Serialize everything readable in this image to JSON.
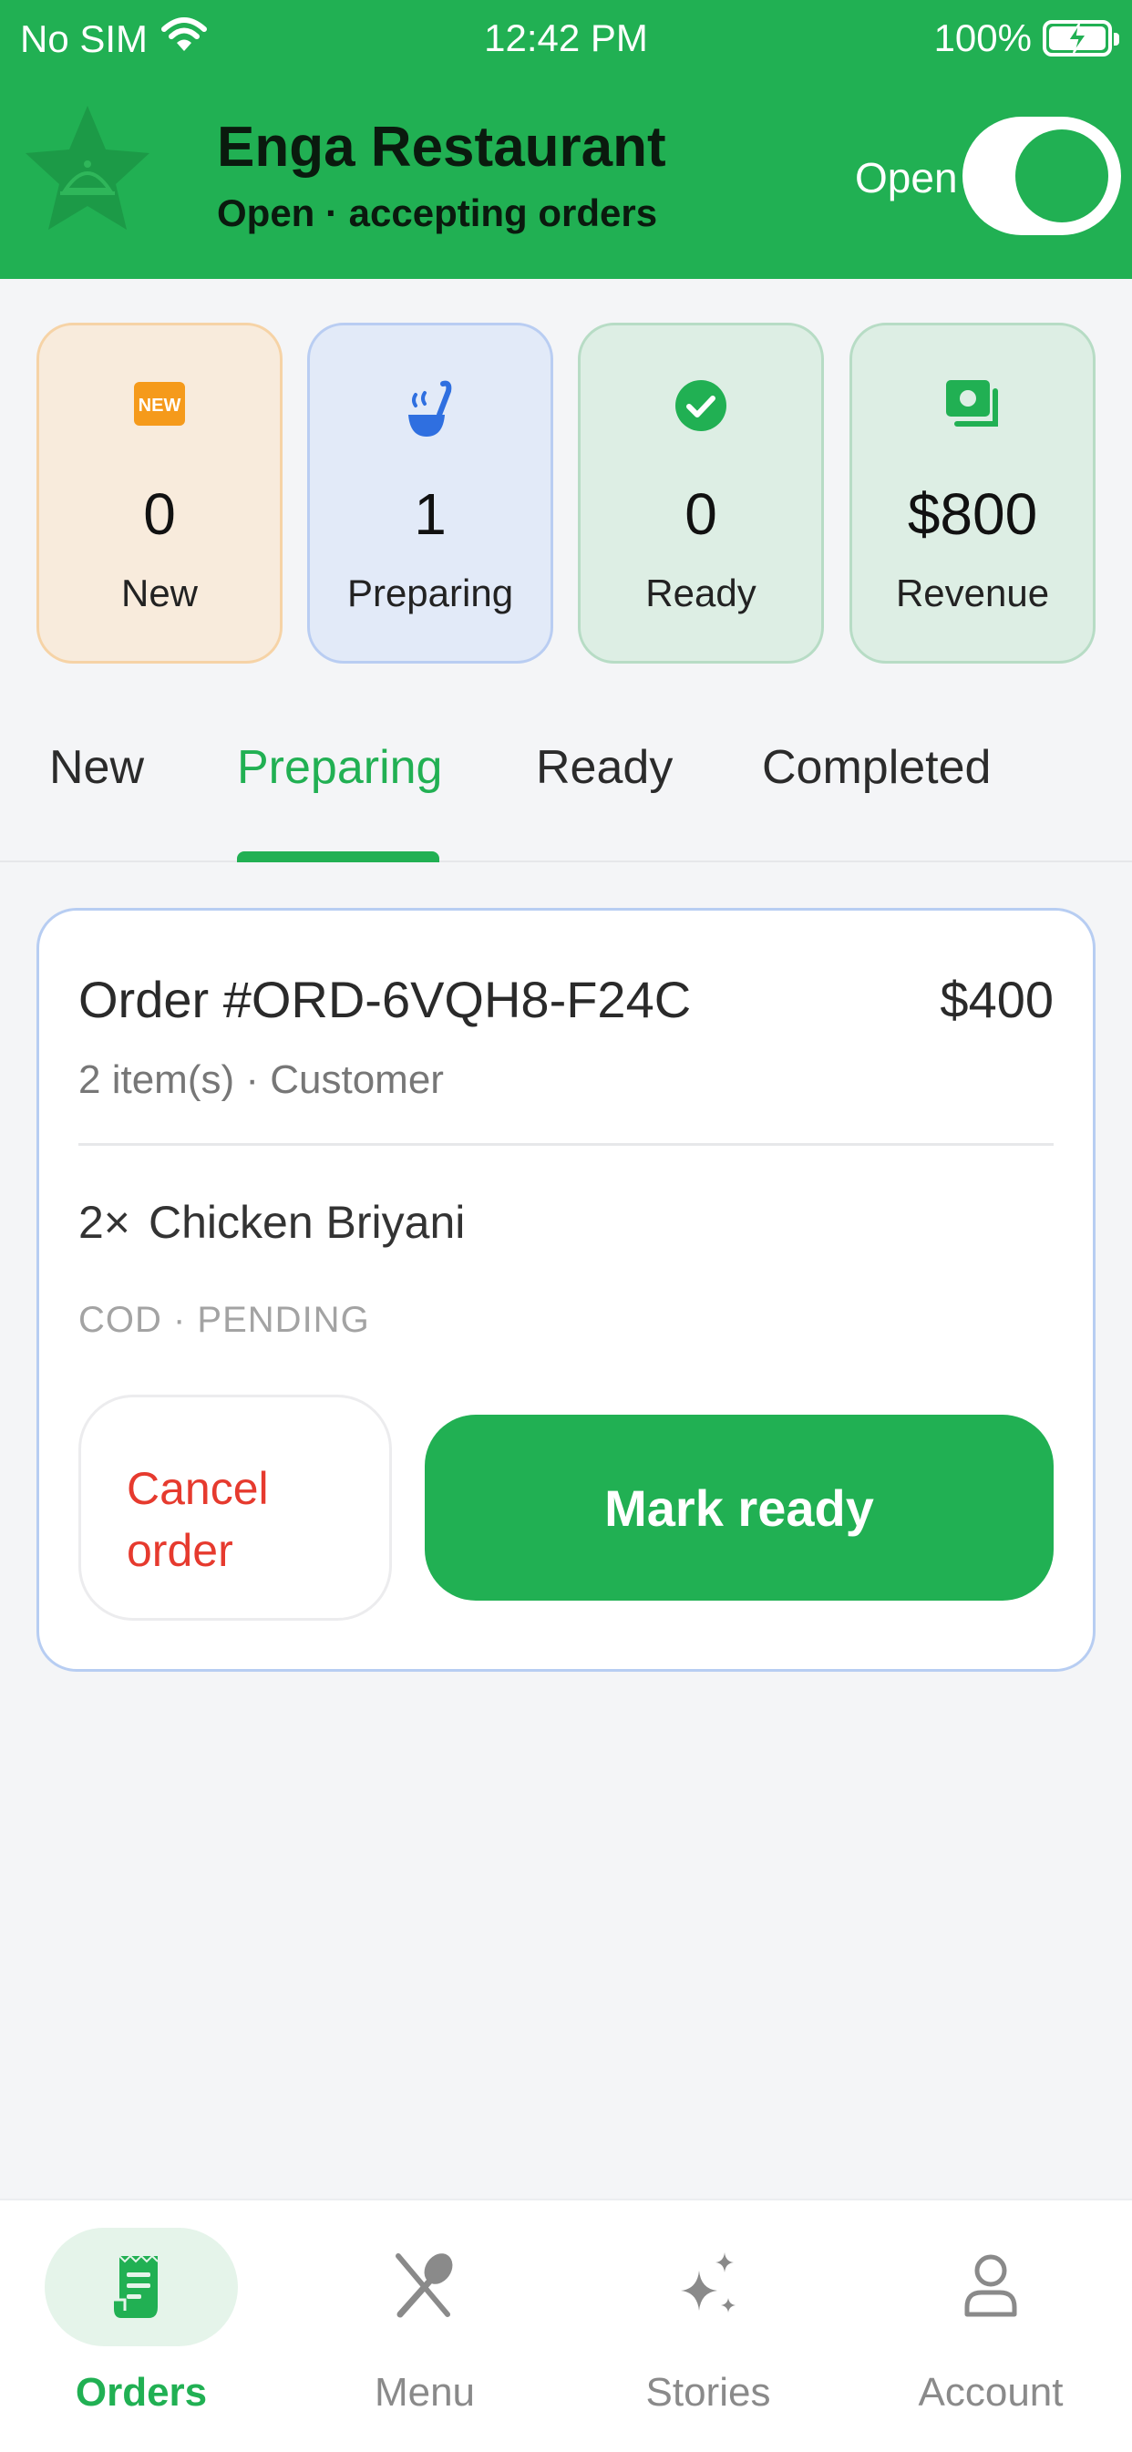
{
  "status_bar": {
    "carrier": "No SIM",
    "time": "12:42 PM",
    "battery": "100%"
  },
  "header": {
    "restaurant_name": "Enga Restaurant",
    "status_text": "Open · accepting orders",
    "open_label": "Open",
    "open": true
  },
  "stats": {
    "new": {
      "value": "0",
      "label": "New",
      "badge": "NEW"
    },
    "preparing": {
      "value": "1",
      "label": "Preparing"
    },
    "ready": {
      "value": "0",
      "label": "Ready"
    },
    "revenue": {
      "value": "$800",
      "label": "Revenue"
    }
  },
  "tabs": [
    {
      "label": "New"
    },
    {
      "label": "Preparing",
      "active": true
    },
    {
      "label": "Ready"
    },
    {
      "label": "Completed"
    }
  ],
  "order": {
    "id": "Order #ORD-6VQH8-F24C",
    "total": "$400",
    "subtitle": "2 item(s) · Customer",
    "items": [
      {
        "qty": "2×",
        "name": "Chicken Briyani"
      }
    ],
    "payment": "COD · PENDING",
    "cancel_label": "Cancel order",
    "ready_label": "Mark ready"
  },
  "nav": [
    {
      "label": "Orders",
      "icon": "receipt-icon",
      "active": true
    },
    {
      "label": "Menu",
      "icon": "utensils-icon"
    },
    {
      "label": "Stories",
      "icon": "sparkles-icon"
    },
    {
      "label": "Account",
      "icon": "user-icon"
    }
  ],
  "colors": {
    "brand": "#21b053",
    "danger": "#e63a2e",
    "background": "#f4f5f7"
  }
}
